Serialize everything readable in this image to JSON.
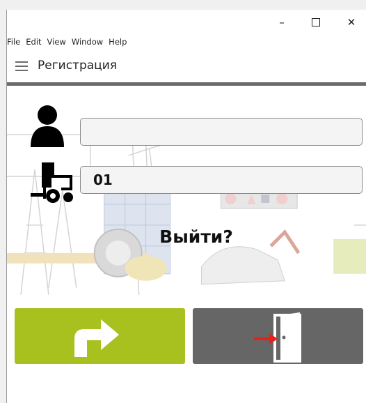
{
  "window": {
    "controls": {
      "minimize": "–",
      "close": "✕"
    }
  },
  "menu": [
    "File",
    "Edit",
    "View",
    "Window",
    "Help"
  ],
  "header": {
    "title": "Регистрация"
  },
  "fields": {
    "user": {
      "value": ""
    },
    "forklift": {
      "value": "01"
    }
  },
  "dialog": {
    "question": "Выйти?"
  },
  "buttons": {
    "confirm": {
      "icon": "arrow-turn-right-icon",
      "color": "#a9c11f"
    },
    "exit": {
      "icon": "door-exit-icon",
      "color": "#666666"
    }
  }
}
